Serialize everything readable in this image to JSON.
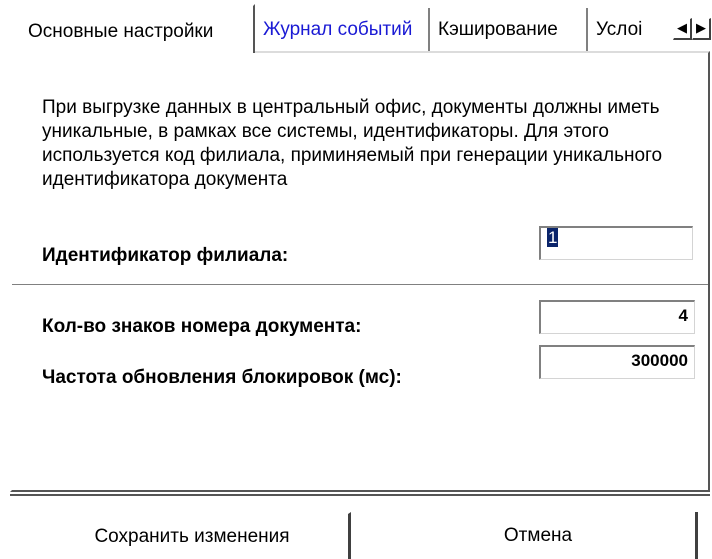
{
  "tabs": [
    {
      "label": "Основные настройки"
    },
    {
      "label": "Журнал событий"
    },
    {
      "label": "Кэширование"
    },
    {
      "label": "Услоі"
    }
  ],
  "tab_scroll": {
    "left_icon": "◀",
    "right_icon": "▶"
  },
  "description": "При выгрузке данных в центральный офис, документы должны иметь уникальные, в рамках все системы, идентификаторы. Для этого используется код филиала, приминяемый при генерации уникального идентификатора документа",
  "branch": {
    "label": "Идентификатор филиала:",
    "value": "1"
  },
  "doc_digits": {
    "label": "Кол-во знаков номера документа:",
    "value": "4"
  },
  "lock_refresh": {
    "label": "Частота обновления блокировок (мс):",
    "value": "300000"
  },
  "buttons": {
    "save": "Сохранить изменения",
    "cancel": "Отмена"
  },
  "colors": {
    "active_link_tab": "#1a1ad4",
    "selection": "#0a246a"
  }
}
